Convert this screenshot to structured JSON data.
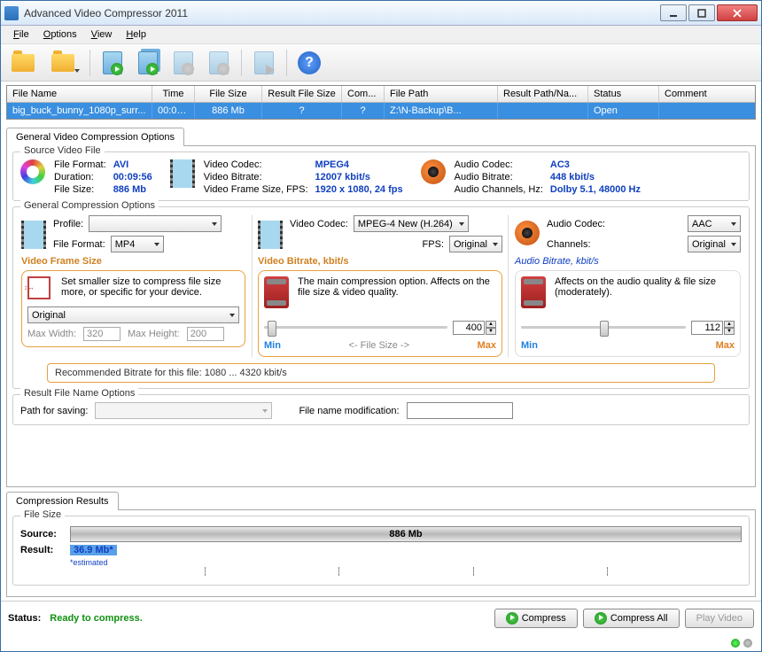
{
  "window": {
    "title": "Advanced Video Compressor 2011"
  },
  "menu": {
    "file": "File",
    "options": "Options",
    "view": "View",
    "help": "Help"
  },
  "grid": {
    "headers": {
      "name": "File Name",
      "time": "Time",
      "size": "File Size",
      "rsize": "Result File Size",
      "comp": "Com...",
      "path": "File Path",
      "rpath": "Result Path/Na...",
      "status": "Status",
      "comment": "Comment"
    },
    "row": {
      "name": "big_buck_bunny_1080p_surr...",
      "time": "00:09...",
      "size": "886 Mb",
      "rsize": "?",
      "comp": "?",
      "path": "Z:\\N-Backup\\B...",
      "rpath": "",
      "status": "Open",
      "comment": ""
    }
  },
  "tabs": {
    "general": "General Video Compression Options"
  },
  "source": {
    "title": "Source Video File",
    "file": {
      "format_l": "File Format:",
      "format_v": "AVI",
      "dur_l": "Duration:",
      "dur_v": "00:09:56",
      "size_l": "File Size:",
      "size_v": "886 Mb"
    },
    "video": {
      "codec_l": "Video Codec:",
      "codec_v": "MPEG4",
      "br_l": "Video Bitrate:",
      "br_v": "12007 kbit/s",
      "fs_l": "Video Frame Size, FPS:",
      "fs_v": "1920 x 1080, 24 fps"
    },
    "audio": {
      "codec_l": "Audio Codec:",
      "codec_v": "AC3",
      "br_l": "Audio Bitrate:",
      "br_v": "448 kbit/s",
      "ch_l": "Audio Channels, Hz:",
      "ch_v": "Dolby 5.1, 48000 Hz"
    }
  },
  "gco": {
    "title": "General Compression Options",
    "profile_l": "Profile:",
    "profile_v": "",
    "format_l": "File Format:",
    "format_v": "MP4",
    "vfs_title": "Video Frame Size",
    "vfs_help": "Set smaller size to compress file size more, or specific for your device.",
    "vfs_combo": "Original",
    "maxw_l": "Max Width:",
    "maxw_v": "320",
    "maxh_l": "Max Height:",
    "maxh_v": "200",
    "vcodec_l": "Video Codec:",
    "vcodec_v": "MPEG-4 New (H.264)",
    "fps_l": "FPS:",
    "fps_v": "Original",
    "vbr_title": "Video Bitrate, kbit/s",
    "vbr_help": "The main compression option. Affects on the file size & video quality.",
    "vbr_val": "400",
    "min": "Min",
    "max": "Max",
    "mid": "<-  File Size  ->",
    "rec": "Recommended Bitrate for this file: 1080 ... 4320 kbit/s",
    "acodec_l": "Audio Codec:",
    "acodec_v": "AAC",
    "ach_l": "Channels:",
    "ach_v": "Original",
    "abr_title": "Audio Bitrate, kbit/s",
    "abr_help": "Affects on the audio quality & file size (moderately).",
    "abr_val": "112"
  },
  "rfn": {
    "title": "Result File Name Options",
    "path_l": "Path for saving:",
    "mod_l": "File name modification:"
  },
  "results": {
    "tab": "Compression Results",
    "fs_title": "File Size",
    "src_l": "Source:",
    "src_v": "886 Mb",
    "res_l": "Result:",
    "res_v": "36.9 Mb*",
    "est": "*estimated"
  },
  "footer": {
    "status_l": "Status:",
    "status_v": "Ready to compress.",
    "compress": "Compress",
    "compress_all": "Compress All",
    "play": "Play Video"
  }
}
